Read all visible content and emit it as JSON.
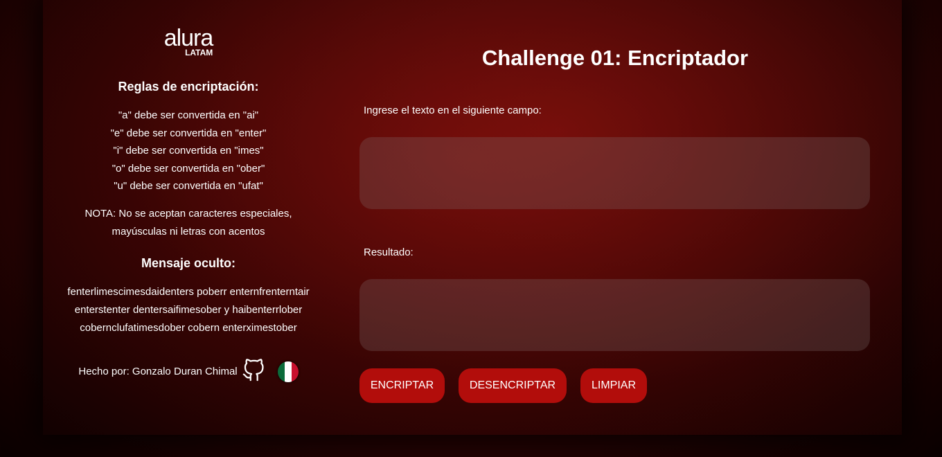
{
  "logo": {
    "name": "alura",
    "sub": "LATAM"
  },
  "sidebar": {
    "rules_title": "Reglas de encriptación:",
    "rules": [
      "\"a\" debe ser convertida en \"ai\"",
      "\"e\" debe ser convertida en \"enter\"",
      "\"i\" debe ser convertida en \"imes\"",
      "\"o\" debe ser convertida en \"ober\"",
      "\"u\" debe ser convertida en \"ufat\""
    ],
    "note_1": "NOTA: No se aceptan caracteres especiales,",
    "note_2": "mayúsculas ni letras con acentos",
    "hidden_title": "Mensaje oculto:",
    "hidden_lines": [
      "fenterlimescimesdaidenters poberr enternfrenterntair",
      "enterstenter dentersaifimesober y haibenterrlober",
      "cobernclufatimesdober cobern enterximestober"
    ],
    "made_by": "Hecho por: Gonzalo Duran Chimal",
    "icons": [
      "github-icon",
      "mexico-flag-icon"
    ]
  },
  "main": {
    "title": "Challenge 01: Encriptador",
    "input_label": "Ingrese el texto en el siguiente campo:",
    "input_value": "",
    "result_label": "Resultado:",
    "result_value": "",
    "buttons": {
      "encrypt": "ENCRIPTAR",
      "decrypt": "DESENCRIPTAR",
      "clear": "LIMPIAR"
    }
  },
  "colors": {
    "button": "#b20d0b"
  }
}
